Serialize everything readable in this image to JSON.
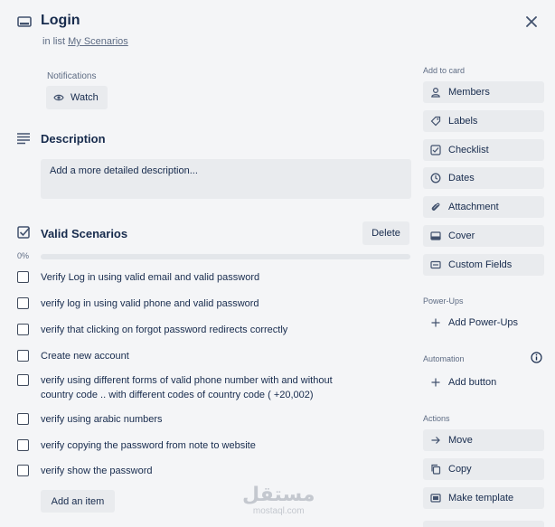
{
  "card": {
    "title": "Login",
    "in_list_prefix": "in list",
    "list_name": "My Scenarios"
  },
  "notifications": {
    "label": "Notifications",
    "watch_label": "Watch"
  },
  "description": {
    "title": "Description",
    "placeholder": "Add a more detailed description..."
  },
  "checklist": {
    "title": "Valid Scenarios",
    "delete_label": "Delete",
    "progress_text": "0%",
    "progress_fraction": 0,
    "items": [
      "Verify Log in using valid email and valid password",
      "verify log in using valid phone and valid password",
      "verify that clicking on forgot password redirects correctly",
      "Create new account",
      "verify using different forms of valid phone number with and without country code .. with different codes of country code ( +20,002)",
      "verify using arabic numbers",
      "verify copying the password from note to website",
      "verify show the password"
    ],
    "add_item_label": "Add an item"
  },
  "sidebar": {
    "add_to_card_label": "Add to card",
    "add_to_card": [
      {
        "label": "Members",
        "icon": "person-icon"
      },
      {
        "label": "Labels",
        "icon": "tag-icon"
      },
      {
        "label": "Checklist",
        "icon": "checkbox-icon"
      },
      {
        "label": "Dates",
        "icon": "clock-icon"
      },
      {
        "label": "Attachment",
        "icon": "paperclip-icon"
      },
      {
        "label": "Cover",
        "icon": "cover-icon"
      },
      {
        "label": "Custom Fields",
        "icon": "fields-icon"
      }
    ],
    "power_ups_label": "Power-Ups",
    "add_power_ups": "Add Power-Ups",
    "automation_label": "Automation",
    "add_button": "Add button",
    "actions_label": "Actions",
    "actions": [
      {
        "label": "Move",
        "icon": "arrow-right-icon"
      },
      {
        "label": "Copy",
        "icon": "copy-icon"
      },
      {
        "label": "Make template",
        "icon": "template-icon"
      }
    ]
  },
  "watermark": {
    "arabic": "مستقل",
    "latin": "mostaql.com"
  },
  "colors": {
    "background": "#f4f5f7",
    "button": "#e9ebee",
    "text": "#172b4d",
    "muted": "#5e6c84"
  }
}
